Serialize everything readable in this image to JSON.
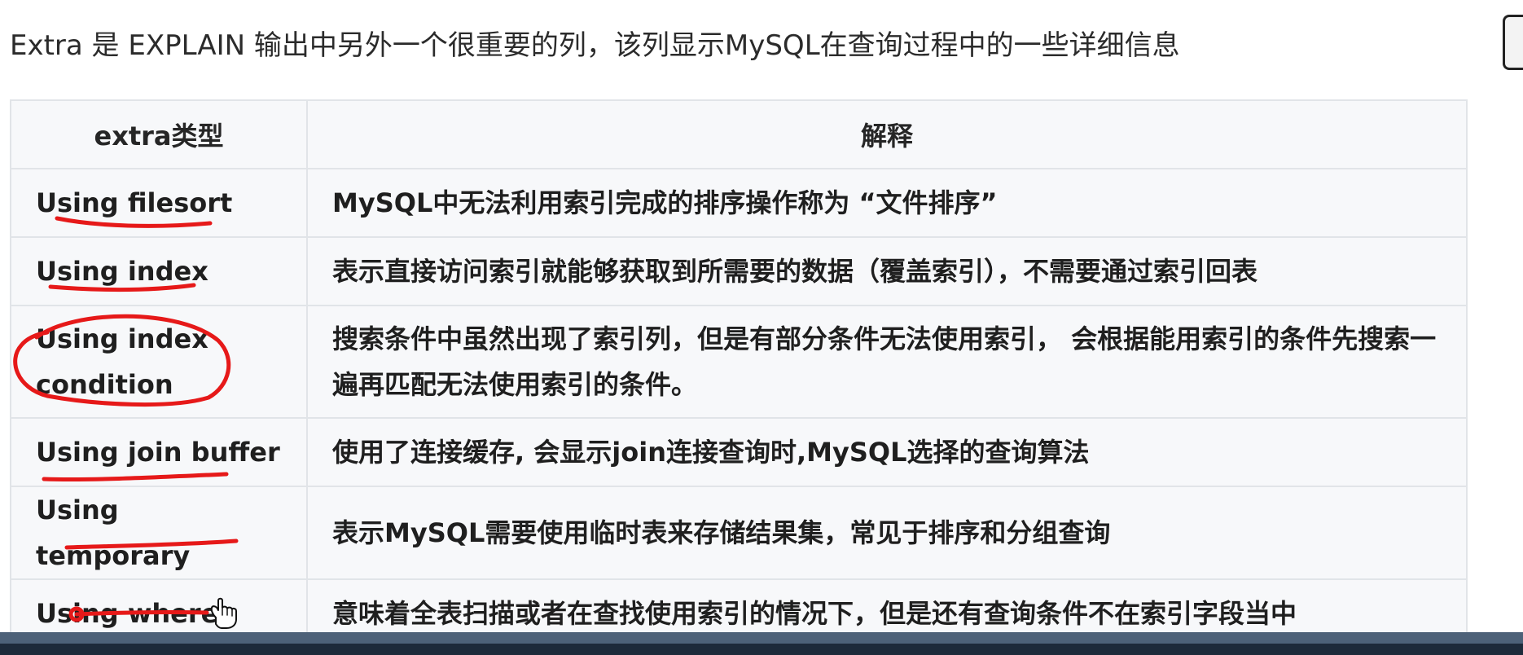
{
  "intro_text": "Extra 是 EXPLAIN 输出中另外一个很重要的列，该列显示MySQL在查询过程中的一些详细信息",
  "table": {
    "headers": [
      "extra类型",
      "解释"
    ],
    "rows": [
      {
        "type": "Using filesort",
        "description": "MySQL中无法利用索引完成的排序操作称为 “文件排序”"
      },
      {
        "type": "Using index",
        "description": "表示直接访问索引就能够获取到所需要的数据（覆盖索引），不需要通过索引回表"
      },
      {
        "type": "Using index condition",
        "description": "搜索条件中虽然出现了索引列，但是有部分条件无法使用索引， 会根据能用索引的条件先搜索一遍再匹配无法使用索引的条件。"
      },
      {
        "type": "Using join buffer",
        "description": "使用了连接缓存, 会显示join连接查询时,MySQL选择的查询算法"
      },
      {
        "type": "Using temporary",
        "description": "表示MySQL需要使用临时表来存储结果集，常见于排序和分组查询"
      },
      {
        "type": "Using where",
        "description": "意味着全表扫描或者在查找使用索引的情况下，但是还有查询条件不在索引字段当中"
      }
    ]
  },
  "annotations": {
    "color": "#e61919",
    "cursor_icon": "hand-pointer-icon"
  },
  "theme": {
    "table_bg": "#f7f8fa",
    "border": "#e1e4e8",
    "bottom_bar": "#1d2a3a"
  }
}
